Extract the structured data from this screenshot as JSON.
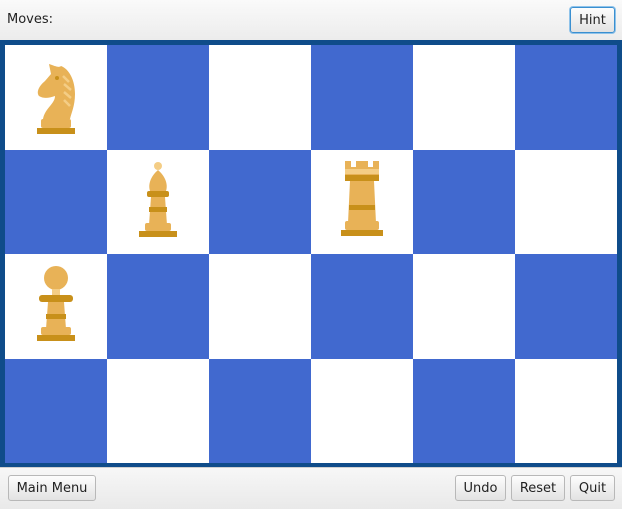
{
  "header": {
    "moves_label": "Moves:",
    "hint_label": "Hint"
  },
  "footer": {
    "main_menu_label": "Main Menu",
    "undo_label": "Undo",
    "reset_label": "Reset",
    "quit_label": "Quit"
  },
  "board": {
    "rows": 4,
    "cols": 6,
    "light_color": "#ffffff",
    "dark_color": "#4169cf",
    "frame_color": "#0f4c8a",
    "pieces": [
      {
        "type": "knight",
        "row": 0,
        "col": 0,
        "color": "gold"
      },
      {
        "type": "bishop",
        "row": 1,
        "col": 1,
        "color": "gold"
      },
      {
        "type": "rook",
        "row": 1,
        "col": 3,
        "color": "gold"
      },
      {
        "type": "pawn",
        "row": 2,
        "col": 0,
        "color": "gold"
      }
    ],
    "piece_colors": {
      "body": "#e8b257",
      "accent": "#c8901a",
      "highlight": "#f4cd85"
    }
  }
}
